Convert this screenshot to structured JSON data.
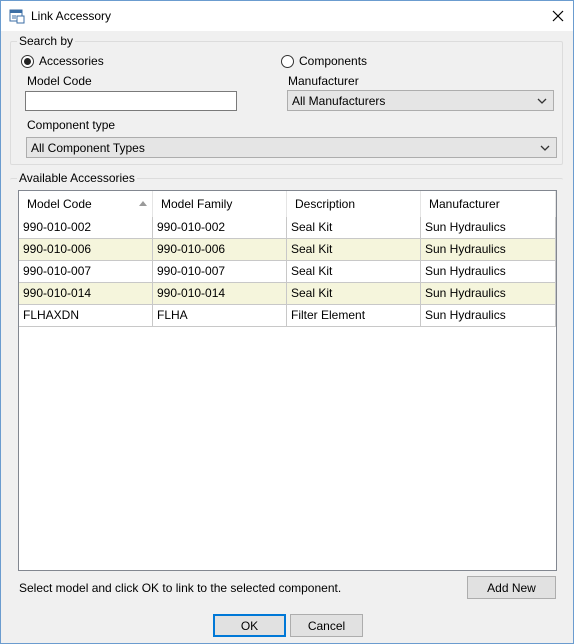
{
  "window": {
    "title": "Link Accessory"
  },
  "search_by": {
    "group_label": "Search by",
    "accessories_label": "Accessories",
    "accessories_selected": true,
    "components_label": "Components",
    "components_selected": false,
    "model_code_label": "Model Code",
    "model_code_value": "",
    "manufacturer_label": "Manufacturer",
    "manufacturer_value": "All Manufacturers",
    "component_type_label": "Component type",
    "component_type_value": "All Component Types"
  },
  "available": {
    "group_label": "Available Accessories",
    "columns": [
      "Model Code",
      "Model Family",
      "Description",
      "Manufacturer"
    ],
    "rows": [
      [
        "990-010-002",
        "990-010-002",
        "Seal Kit",
        "Sun Hydraulics"
      ],
      [
        "990-010-006",
        "990-010-006",
        "Seal Kit",
        "Sun Hydraulics"
      ],
      [
        "990-010-007",
        "990-010-007",
        "Seal Kit",
        "Sun Hydraulics"
      ],
      [
        "990-010-014",
        "990-010-014",
        "Seal Kit",
        "Sun Hydraulics"
      ],
      [
        "FLHAXDN",
        "FLHA",
        "Filter Element",
        "Sun Hydraulics"
      ]
    ]
  },
  "footer": {
    "hint": "Select model and click OK to link to the selected component.",
    "add_new_label": "Add New",
    "ok_label": "OK",
    "cancel_label": "Cancel"
  },
  "colors": {
    "alt_row": "#f5f5dc",
    "default_button_border": "#0078d7"
  }
}
